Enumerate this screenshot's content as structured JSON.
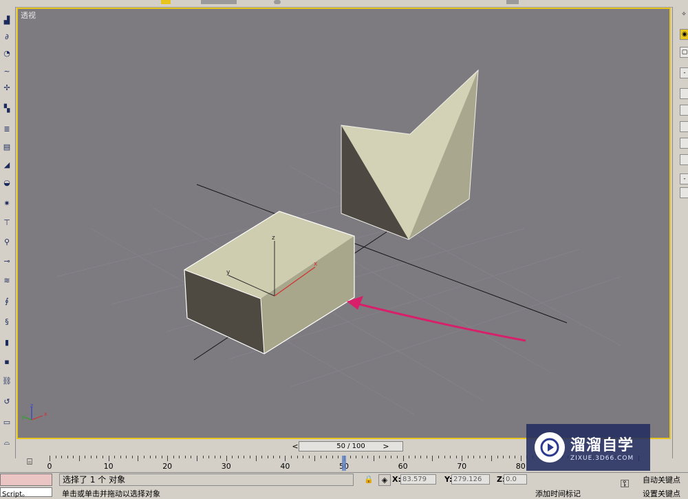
{
  "viewport": {
    "label": "透视"
  },
  "gizmo": {
    "z": "z",
    "y": "y",
    "x": "x"
  },
  "axis_tripod": {
    "z": "z",
    "y": "y",
    "x": "x"
  },
  "time_slider": {
    "label": "50 / 100",
    "prev": "<",
    "next": ">"
  },
  "trackbar": {
    "ticks": [
      "0",
      "10",
      "20",
      "30",
      "40",
      "50",
      "60",
      "70",
      "80"
    ],
    "current": 50
  },
  "status": {
    "selection": "选择了 1 个 对象",
    "prompt": "单击或单击并拖动以选择对象",
    "script": "Script。",
    "x_label": "X:",
    "x_value": "83.579",
    "y_label": "Y:",
    "y_value": "279.126",
    "z_label": "Z:",
    "z_value": "0.0",
    "add_time_tag": "添加时间标记",
    "auto_key": "自动关键点",
    "set_key": "设置关键点"
  },
  "watermark": {
    "title": "溜溜自学",
    "subtitle": "ZIXUE.3D66.COM"
  },
  "colors": {
    "viewport_bg": "#7d7b80",
    "active_border": "#e8c51c",
    "object_light": "#c9c8aa",
    "object_dark": "#4a4740",
    "arrow": "#d81f6a"
  }
}
